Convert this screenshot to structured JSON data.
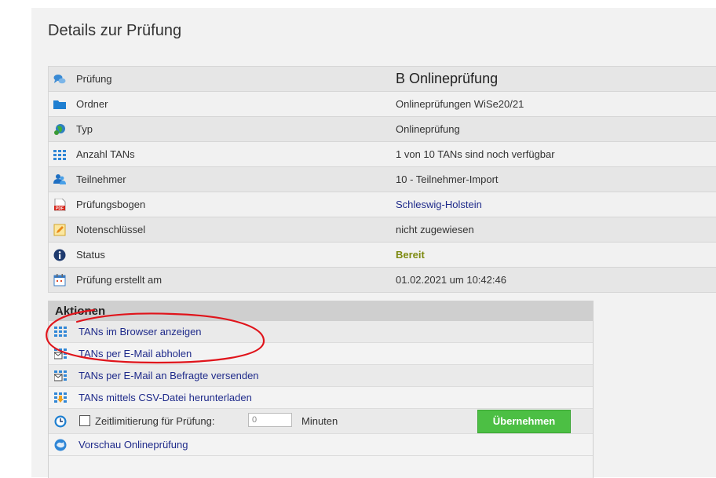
{
  "page": {
    "title": "Details zur Prüfung"
  },
  "details": [
    {
      "icon": "speech-bubbles-icon",
      "label": "Prüfung",
      "value": "B Onlineprüfung"
    },
    {
      "icon": "folder-icon",
      "label": "Ordner",
      "value": "Onlineprüfungen WiSe20/21"
    },
    {
      "icon": "type-icon",
      "label": "Typ",
      "value": "Onlineprüfung"
    },
    {
      "icon": "grid-icon",
      "label": "Anzahl TANs",
      "value": "1 von 10 TANs sind noch verfügbar"
    },
    {
      "icon": "users-icon",
      "label": "Teilnehmer",
      "value": "10 - Teilnehmer-Import"
    },
    {
      "icon": "pdf-icon",
      "label": "Prüfungsbogen",
      "value": "Schleswig-Holstein"
    },
    {
      "icon": "pencil-icon",
      "label": "Notenschlüssel",
      "value": "nicht zugewiesen"
    },
    {
      "icon": "info-icon",
      "label": "Status",
      "value": "Bereit"
    },
    {
      "icon": "calendar-icon",
      "label": "Prüfung erstellt am",
      "value": "01.02.2021 um 10:42:46"
    }
  ],
  "actions": {
    "header": "Aktionen",
    "items": [
      {
        "icon": "tan-grid-icon",
        "label": "TANs im Browser anzeigen"
      },
      {
        "icon": "tan-mail-icon",
        "label": "TANs per E-Mail abholen"
      },
      {
        "icon": "tan-mail-icon",
        "label": "TANs per E-Mail an Befragte versenden"
      },
      {
        "icon": "tan-download-icon",
        "label": "TANs mittels CSV-Datei herunterladen"
      }
    ],
    "time_limit": {
      "label": "Zeitlimitierung für Prüfung:",
      "value": "0",
      "unit": "Minuten",
      "checked": false,
      "apply_label": "Übernehmen"
    },
    "preview_label": "Vorschau Onlineprüfung"
  },
  "colors": {
    "link": "#1e2a8a",
    "status": "#7d8a10",
    "apply_button": "#4cbf44",
    "annotation": "#e0141b"
  }
}
